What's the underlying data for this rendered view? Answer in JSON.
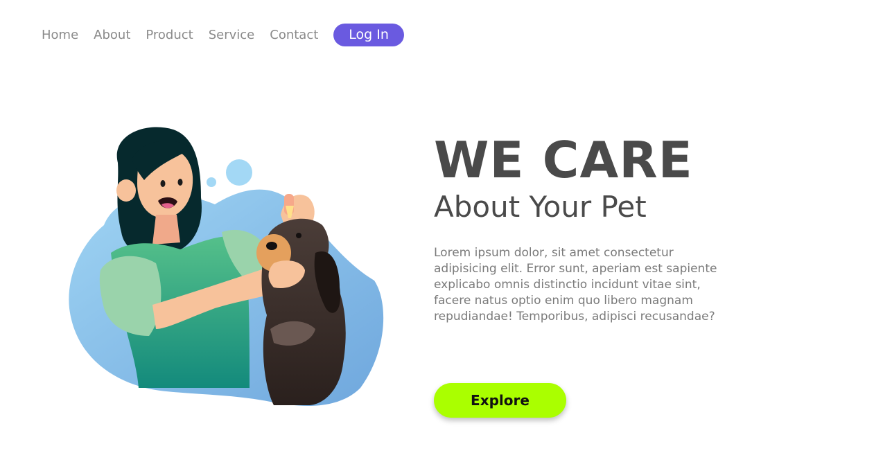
{
  "nav": {
    "items": [
      {
        "label": "Home"
      },
      {
        "label": "About"
      },
      {
        "label": "Product"
      },
      {
        "label": "Service"
      },
      {
        "label": "Contact"
      }
    ],
    "login_label": "Log In"
  },
  "hero": {
    "title": "WE CARE",
    "subtitle": "About Your Pet",
    "description": "Lorem ipsum dolor, sit amet consectetur adipisicing elit. Error sunt, aperiam est sapiente explicabo omnis distinctio incidunt vitae sint, facere natus optio enim quo libero magnam repudiandae! Temporibus, adipisci recusandae?",
    "cta_label": "Explore"
  },
  "illustration": {
    "subject": "woman-giving-dog-eye-drops"
  },
  "colors": {
    "accent": "#6a5ae0",
    "cta": "#aaff00",
    "heading": "#4a4a4a",
    "body_text": "#7a7a7a",
    "nav_text": "#8a8a8a"
  }
}
